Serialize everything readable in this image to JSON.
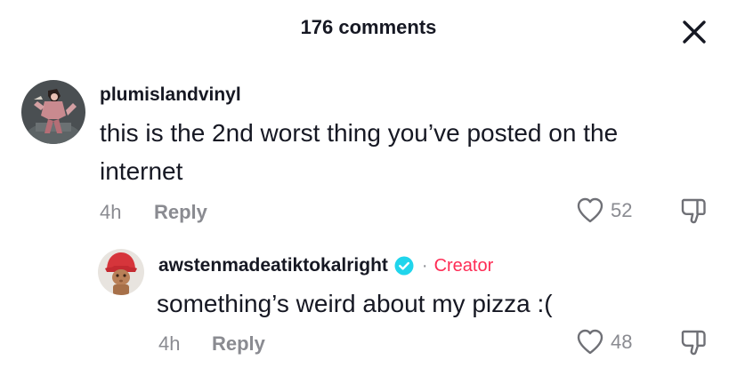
{
  "header": {
    "title": "176 comments",
    "close_icon": "close-icon"
  },
  "comments": [
    {
      "username": "plumislandvinyl",
      "avatar": "user-avatar",
      "text_line1": "this is the 2nd worst thing you’ve posted on the",
      "text_line2": "internet",
      "time": "4h",
      "reply_label": "Reply",
      "likes": "52",
      "like_icon": "heart-outline-icon",
      "dislike_icon": "thumbs-down-icon"
    }
  ],
  "replies": [
    {
      "username": "awstenmadeatiktokalright",
      "verified_icon": "verified-badge-icon",
      "badge_separator": "·",
      "badge": "Creator",
      "badge_color": "#fe2c55",
      "avatar": "creator-avatar",
      "text": "something’s weird about my pizza :(",
      "time": "4h",
      "reply_label": "Reply",
      "likes": "48",
      "like_icon": "heart-outline-icon",
      "dislike_icon": "thumbs-down-icon"
    }
  ],
  "colors": {
    "text_primary": "#161823",
    "text_secondary": "#8a8b91",
    "accent": "#fe2c55",
    "verified": "#20d5ec"
  }
}
